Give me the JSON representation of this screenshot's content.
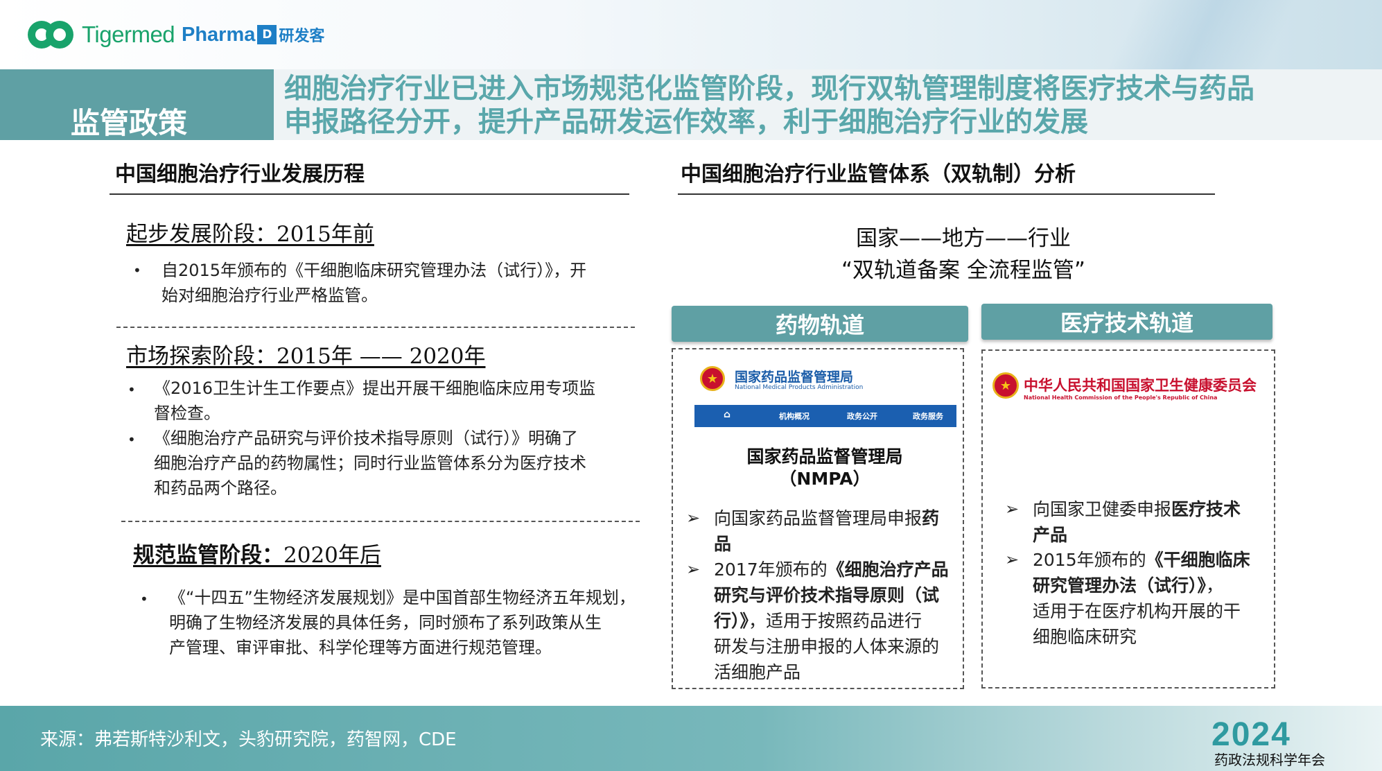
{
  "header": {
    "logo_tigermed": "Tigermed",
    "logo_pharma": "Pharma",
    "logo_pharma_box": "D",
    "logo_pharma_cn": "研发客"
  },
  "section_tag": "监管政策",
  "title_lines": [
    "细胞治疗行业已进入市场规范化监管阶段，现行双轨管理制度将医疗技术与药品",
    "申报路径分开，提升产品研发运作效率，利于细胞治疗行业的发展"
  ],
  "left": {
    "heading": "中国细胞治疗行业发展历程",
    "stages": [
      {
        "title": "起步发展阶段：2015年前",
        "bullets": [
          [
            "自2015年颁布的《干细胞临床研究管理办法（试行）》，开",
            "始对细胞治疗行业严格监管。"
          ]
        ]
      },
      {
        "title": "市场探索阶段：2015年 —— 2020年",
        "bullets": [
          [
            "《2016卫生计生工作要点》提出开展干细胞临床应用专项监",
            "督检查。"
          ],
          [
            "《细胞治疗产品研究与评价技术指导原则（试行）》明确了",
            "细胞治疗产品的药物属性；同时行业监管体系分为医疗技术",
            "和药品两个路径。"
          ]
        ]
      },
      {
        "title_bold": "规范监管阶段：",
        "title_rest": "2020年后",
        "bullets": [
          [
            "《“十四五”生物经济发展规划》是中国首部生物经济五年规划，",
            "明确了生物经济发展的具体任务，同时颁布了系列政策从生",
            "产管理、审评审批、科学伦理等方面进行规范管理。"
          ]
        ]
      }
    ]
  },
  "right": {
    "heading": "中国细胞治疗行业监管体系（双轨制）分析",
    "slogan_line1": "国家——地方——行业",
    "slogan_line2": "“双轨道备案 全流程监管”",
    "drug_track": {
      "label": "药物轨道",
      "agency_cn": "国家药品监督管理局",
      "agency_en": "National Medical Products Administration",
      "nav": [
        "机构概况",
        "政务公开",
        "政务服务"
      ],
      "agency_name_line1": "国家药品监督管理局",
      "agency_name_line2": "（NMPA）",
      "points": [
        {
          "lines": [
            [
              "向国家药品监督管理局申报",
              "药"
            ],
            [
              "",
              "品"
            ]
          ]
        },
        {
          "lines": [
            [
              "2017年颁布的",
              "《细胞治疗产品"
            ],
            [
              "",
              "研究与评价技术指导原则（试"
            ],
            [
              "",
              "行）》"
            ],
            [
              "，适用于按照药品进行",
              ""
            ],
            [
              "研发与注册申报的人体来源的",
              ""
            ],
            [
              "活细胞产品",
              ""
            ]
          ]
        }
      ]
    },
    "med_track": {
      "label": "医疗技术轨道",
      "agency_cn": "中华人民共和国国家卫生健康委员会",
      "agency_en": "National Health Commission of the People's Republic of China",
      "points": [
        {
          "lines": [
            [
              "向国家卫健委申报",
              "医疗技术"
            ],
            [
              "",
              "产品"
            ]
          ]
        },
        {
          "lines": [
            [
              "2015年颁布的",
              "《干细胞临床"
            ],
            [
              "",
              "研究管理办法（试行）》"
            ],
            [
              "，",
              ""
            ],
            [
              "适用于在医疗机构开展的干",
              ""
            ],
            [
              "细胞临床研究",
              ""
            ]
          ]
        }
      ]
    }
  },
  "footer": {
    "source": "来源：弗若斯特沙利文，头豹研究院，药智网，CDE",
    "year": "2024",
    "conference": "药政法规科学年会"
  },
  "colors": {
    "teal": "#5fa0a4",
    "title_teal": "#5aa7ab",
    "tigermed_green": "#19a36b",
    "pharma_blue": "#1e7fc6",
    "nmpa_blue": "#1b5fb0",
    "nhc_red": "#c8102e"
  }
}
